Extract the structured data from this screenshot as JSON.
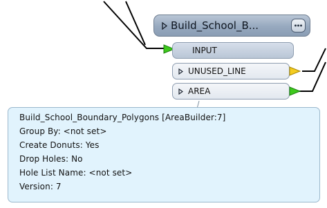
{
  "transformer": {
    "title": "Build_School_B...",
    "more_button_label": "...",
    "header_color": "#97a9bf",
    "icons": {
      "expand": "triangle-right-icon",
      "more": "ellipsis-icon"
    }
  },
  "ports": {
    "input": {
      "label": "INPUT",
      "connector_color": "#3ec91c",
      "icon": "green-arrow-icon"
    },
    "unused_line": {
      "label": "UNUSED_LINE",
      "connector_color": "#f4cc1f",
      "icon": "yellow-arrow-icon"
    },
    "area": {
      "label": "AREA",
      "connector_color": "#3ec91c",
      "icon": "green-arrow-icon"
    }
  },
  "tooltip": {
    "lines": [
      "Build_School_Boundary_Polygons [AreaBuilder:7]",
      "Group By: <not set>",
      "Create Donuts: Yes",
      "Drop Holes: No",
      "Hole List Name: <not set>",
      "Version: 7"
    ],
    "background_color": "#e1f3fd"
  }
}
